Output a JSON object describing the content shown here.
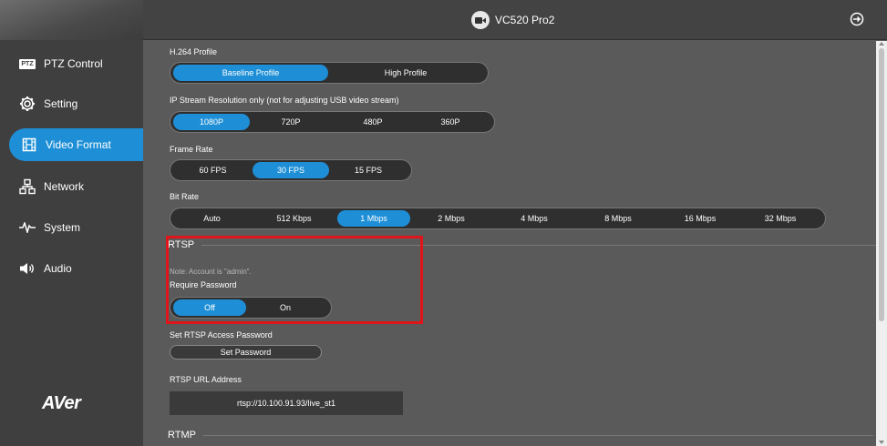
{
  "header": {
    "device_name": "VC520 Pro2"
  },
  "sidebar": {
    "items": [
      {
        "label": "PTZ Control",
        "icon": "ptz-icon"
      },
      {
        "label": "Setting",
        "icon": "gear-icon"
      },
      {
        "label": "Video Format",
        "icon": "film-icon",
        "active": true
      },
      {
        "label": "Network",
        "icon": "network-icon"
      },
      {
        "label": "System",
        "icon": "pulse-icon"
      },
      {
        "label": "Audio",
        "icon": "speaker-icon"
      }
    ],
    "logo": "AVer",
    "ptz_badge": "PTZ"
  },
  "main": {
    "h264": {
      "label": "H.264 Profile",
      "options": [
        "Baseline Profile",
        "High Profile"
      ],
      "selected": "Baseline Profile"
    },
    "resolution": {
      "label": "IP Stream Resolution only (not for adjusting USB video stream)",
      "options": [
        "1080P",
        "720P",
        "480P",
        "360P"
      ],
      "selected": "1080P"
    },
    "frame_rate": {
      "label": "Frame Rate",
      "options": [
        "60 FPS",
        "30 FPS",
        "15 FPS"
      ],
      "selected": "30 FPS"
    },
    "bit_rate": {
      "label": "Bit Rate",
      "options": [
        "Auto",
        "512 Kbps",
        "1 Mbps",
        "2 Mbps",
        "4 Mbps",
        "8 Mbps",
        "16 Mbps",
        "32 Mbps"
      ],
      "selected": "1 Mbps"
    },
    "rtsp": {
      "title": "RTSP",
      "note": "Note: Account is \"admin\".",
      "require_password": {
        "label": "Require Password",
        "options": [
          "Off",
          "On"
        ],
        "selected": "Off"
      },
      "access_password_label": "Set RTSP Access Password",
      "set_password_button": "Set Password",
      "url_label": "RTSP URL Address",
      "url_value": "rtsp://10.100.91.93/live_st1"
    },
    "rtmp": {
      "title": "RTMP"
    }
  },
  "colors": {
    "accent": "#1e8fd6",
    "highlight": "#e0151a",
    "sidebar_bg": "#3f3f3f",
    "main_bg": "#5a5a5a"
  }
}
